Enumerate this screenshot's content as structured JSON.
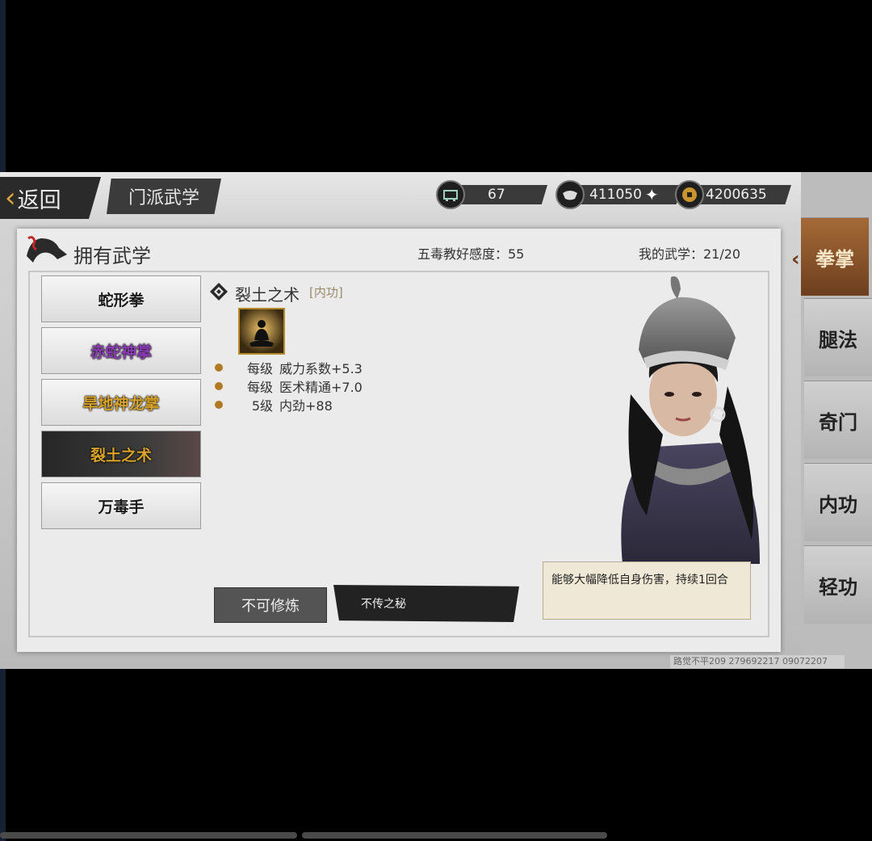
{
  "header": {
    "back_label": "返回",
    "title": "门派武学"
  },
  "resources": [
    {
      "icon": "chest-icon",
      "value": "67"
    },
    {
      "icon": "silver-ingot-icon",
      "value": "411050"
    },
    {
      "icon": "copper-coin-icon",
      "value": "4200635"
    }
  ],
  "panel": {
    "title": "拥有武学",
    "favor_text": "五毒教好感度：55",
    "my_skills_text": "我的武学：21/20"
  },
  "skills": [
    {
      "name": "蛇形拳",
      "color": "#1a1a1a"
    },
    {
      "name": "赤蛇神掌",
      "color": "#8a3db5"
    },
    {
      "name": "旱地神龙掌",
      "color": "#d8a32a"
    },
    {
      "name": "裂土之术",
      "color": "#d8a32a"
    },
    {
      "name": "万毒手",
      "color": "#1a1a1a"
    }
  ],
  "selected": {
    "name": "裂土之术",
    "tag": "[内功]",
    "stats": [
      {
        "level": "每级",
        "text": "威力系数+5.3"
      },
      {
        "level": "每级",
        "text": "医术精通+7.0"
      },
      {
        "level": "5级",
        "text": "内劲+88"
      }
    ],
    "cannot_train": "不可修炼",
    "secret": "不传之秘",
    "description": "能够大幅降低自身伤害，持续1回合"
  },
  "side_tabs": [
    "拳掌",
    "腿法",
    "奇门",
    "内功",
    "轻功"
  ],
  "watermark": "路觉不平209 279692217 09072207"
}
